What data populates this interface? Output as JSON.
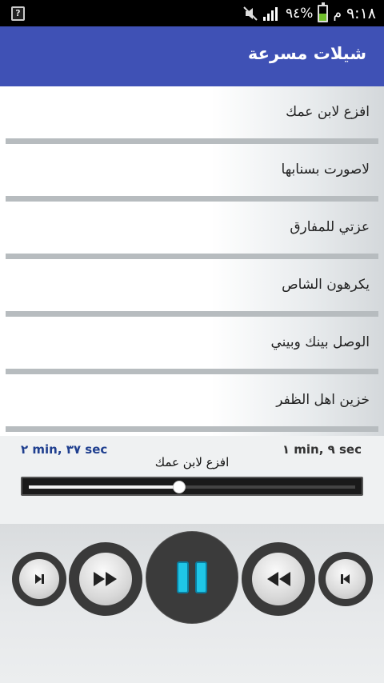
{
  "status_bar": {
    "time": "٩:١٨",
    "ampm": "م",
    "battery_percent": "٩٤%",
    "battery_level": 0.45,
    "left_icon": "unknown-notification-icon"
  },
  "app_bar": {
    "title": "شيلات مسرعة"
  },
  "tracks": [
    {
      "title": "افزع لابن عمك"
    },
    {
      "title": "لاصورت بسنابها"
    },
    {
      "title": "عزتي للمفارق"
    },
    {
      "title": "يكرهون الشاص"
    },
    {
      "title": "الوصل بينك وبيني"
    },
    {
      "title": "خزين اهل الظفر"
    }
  ],
  "player": {
    "total_time": "٢ min, ٣٧ sec",
    "current_time": "١ min, ٩ sec",
    "now_playing": "افزع لابن عمك",
    "progress": 0.46
  },
  "colors": {
    "app_bar": "#3f51b5",
    "pause_icon": "#1fc6e6",
    "time_left": "#1f3f8f"
  },
  "icons": [
    "next-icon",
    "fast-forward-icon",
    "pause-icon",
    "rewind-icon",
    "previous-icon",
    "mute-icon",
    "signal-icon",
    "battery-icon"
  ]
}
